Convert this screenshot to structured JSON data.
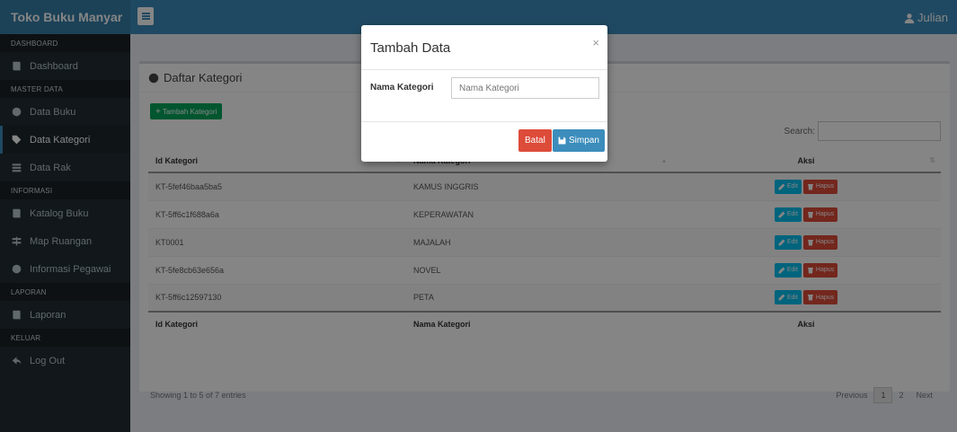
{
  "brand": "Toko Buku Manyar",
  "user": {
    "name": "Julian"
  },
  "sidebar": {
    "sections": [
      {
        "header": "DASHBOARD",
        "items": [
          {
            "label": "Dashboard",
            "icon": "book-icon"
          }
        ]
      },
      {
        "header": "MASTER DATA",
        "items": [
          {
            "label": "Data Buku",
            "icon": "globe-icon"
          },
          {
            "label": "Data Kategori",
            "icon": "tags-icon",
            "active": true
          },
          {
            "label": "Data Rak",
            "icon": "list-icon"
          }
        ]
      },
      {
        "header": "INFORMASI",
        "items": [
          {
            "label": "Katalog Buku",
            "icon": "book-icon"
          },
          {
            "label": "Map Ruangan",
            "icon": "signpost-icon"
          },
          {
            "label": "Informasi Pegawai",
            "icon": "info-icon"
          }
        ]
      },
      {
        "header": "LAPORAN",
        "items": [
          {
            "label": "Laporan",
            "icon": "book-icon"
          }
        ]
      },
      {
        "header": "KELUAR",
        "items": [
          {
            "label": "Log Out",
            "icon": "logout-icon"
          }
        ]
      }
    ]
  },
  "box": {
    "title": "Daftar Kategori",
    "add_button": "Tambah Kategori",
    "search_label": "Search:",
    "columns": [
      "Id Kategori",
      "Nama Kategori",
      "Aksi"
    ],
    "rows": [
      {
        "id": "KT-5fef46baa5ba5",
        "nama": "KAMUS INGGRIS"
      },
      {
        "id": "KT-5ff6c1f688a6a",
        "nama": "KEPERAWATAN"
      },
      {
        "id": "KT0001",
        "nama": "MAJALAH"
      },
      {
        "id": "KT-5fe8cb63e656a",
        "nama": "NOVEL"
      },
      {
        "id": "KT-5ff6c12597130",
        "nama": "PETA"
      }
    ],
    "edit_label": "Edit",
    "delete_label": "Hapus",
    "info": "Showing 1 to 5 of 7 entries",
    "pagination": {
      "previous": "Previous",
      "pages": [
        "1",
        "2"
      ],
      "current": "1",
      "next": "Next"
    }
  },
  "modal": {
    "title": "Tambah Data",
    "close": "×",
    "field_label": "Nama Kategori",
    "field_placeholder": "Nama Kategori",
    "field_value": "",
    "cancel": "Batal",
    "save": "Simpan"
  },
  "colors": {
    "topbar": "#3c8dbc",
    "sidebar": "#222d32",
    "success": "#00a65a",
    "danger": "#dd4b39",
    "info": "#00c0ef"
  }
}
